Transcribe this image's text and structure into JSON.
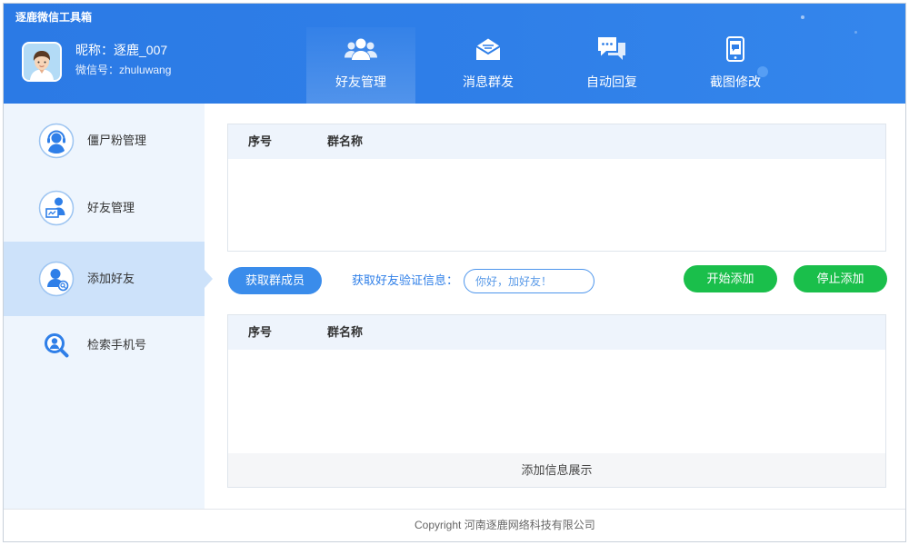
{
  "app": {
    "title": "逐鹿微信工具箱"
  },
  "profile": {
    "nickname": "昵称：逐鹿_007",
    "wechat_id": "微信号：zhuluwang",
    "avatar_icon": "cartoon-avatar"
  },
  "tabs": [
    {
      "label": "好友管理",
      "icon": "users-icon",
      "active": true
    },
    {
      "label": "消息群发",
      "icon": "envelope-icon",
      "active": false
    },
    {
      "label": "自动回复",
      "icon": "chat-bubbles-icon",
      "active": false
    },
    {
      "label": "截图修改",
      "icon": "phone-icon",
      "active": false
    }
  ],
  "sidebar": {
    "items": [
      {
        "label": "僵尸粉管理",
        "icon": "headset-user-icon",
        "active": false
      },
      {
        "label": "好友管理",
        "icon": "user-board-icon",
        "active": false
      },
      {
        "label": "添加好友",
        "icon": "add-friend-icon",
        "active": true
      },
      {
        "label": "检索手机号",
        "icon": "search-user-icon",
        "active": false
      }
    ]
  },
  "group_table": {
    "columns": [
      "序号",
      "群名称"
    ],
    "rows": []
  },
  "controls": {
    "fetch_members_button": "获取群成员",
    "verify_label": "获取好友验证信息：",
    "verify_input": {
      "value": "",
      "placeholder": "你好，加好友！"
    },
    "start_button": "开始添加",
    "stop_button": "停止添加"
  },
  "result_table": {
    "columns": [
      "序号",
      "群名称"
    ],
    "rows": [],
    "footer": "添加信息展示"
  },
  "footer": {
    "copyright": "Copyright 河南逐鹿网络科技有限公司"
  },
  "colors": {
    "header": "#2f7fe8",
    "accent": "#3a8ceb",
    "sidebar_bg": "#eef5fd",
    "sidebar_active": "#cde2fa",
    "success": "#1abf4b",
    "table_header_bg": "#eef4fc"
  }
}
